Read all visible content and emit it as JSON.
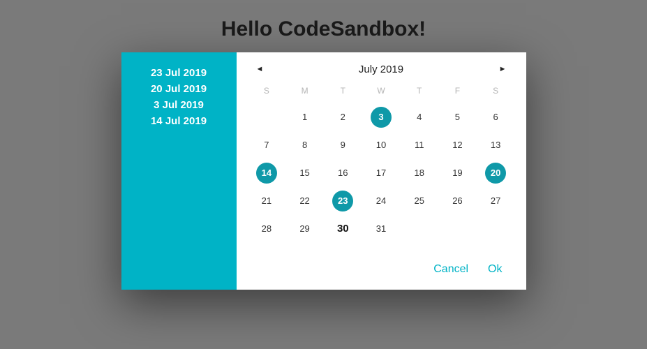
{
  "page": {
    "title": "Hello CodeSandbox!"
  },
  "datepicker": {
    "selected_dates": [
      "23 Jul 2019",
      "20 Jul 2019",
      "3 Jul 2019",
      "14 Jul 2019"
    ],
    "month_label": "July 2019",
    "dow": [
      "S",
      "M",
      "T",
      "W",
      "T",
      "F",
      "S"
    ],
    "weeks": [
      [
        null,
        1,
        2,
        3,
        4,
        5,
        6
      ],
      [
        7,
        8,
        9,
        10,
        11,
        12,
        13
      ],
      [
        14,
        15,
        16,
        17,
        18,
        19,
        20
      ],
      [
        21,
        22,
        23,
        24,
        25,
        26,
        27
      ],
      [
        28,
        29,
        30,
        31,
        null,
        null,
        null
      ]
    ],
    "selected_days": [
      3,
      14,
      20,
      23
    ],
    "today": 30,
    "actions": {
      "cancel": "Cancel",
      "ok": "Ok"
    },
    "colors": {
      "accent": "#00b3c6",
      "selected_circle": "#0f99a8"
    }
  }
}
